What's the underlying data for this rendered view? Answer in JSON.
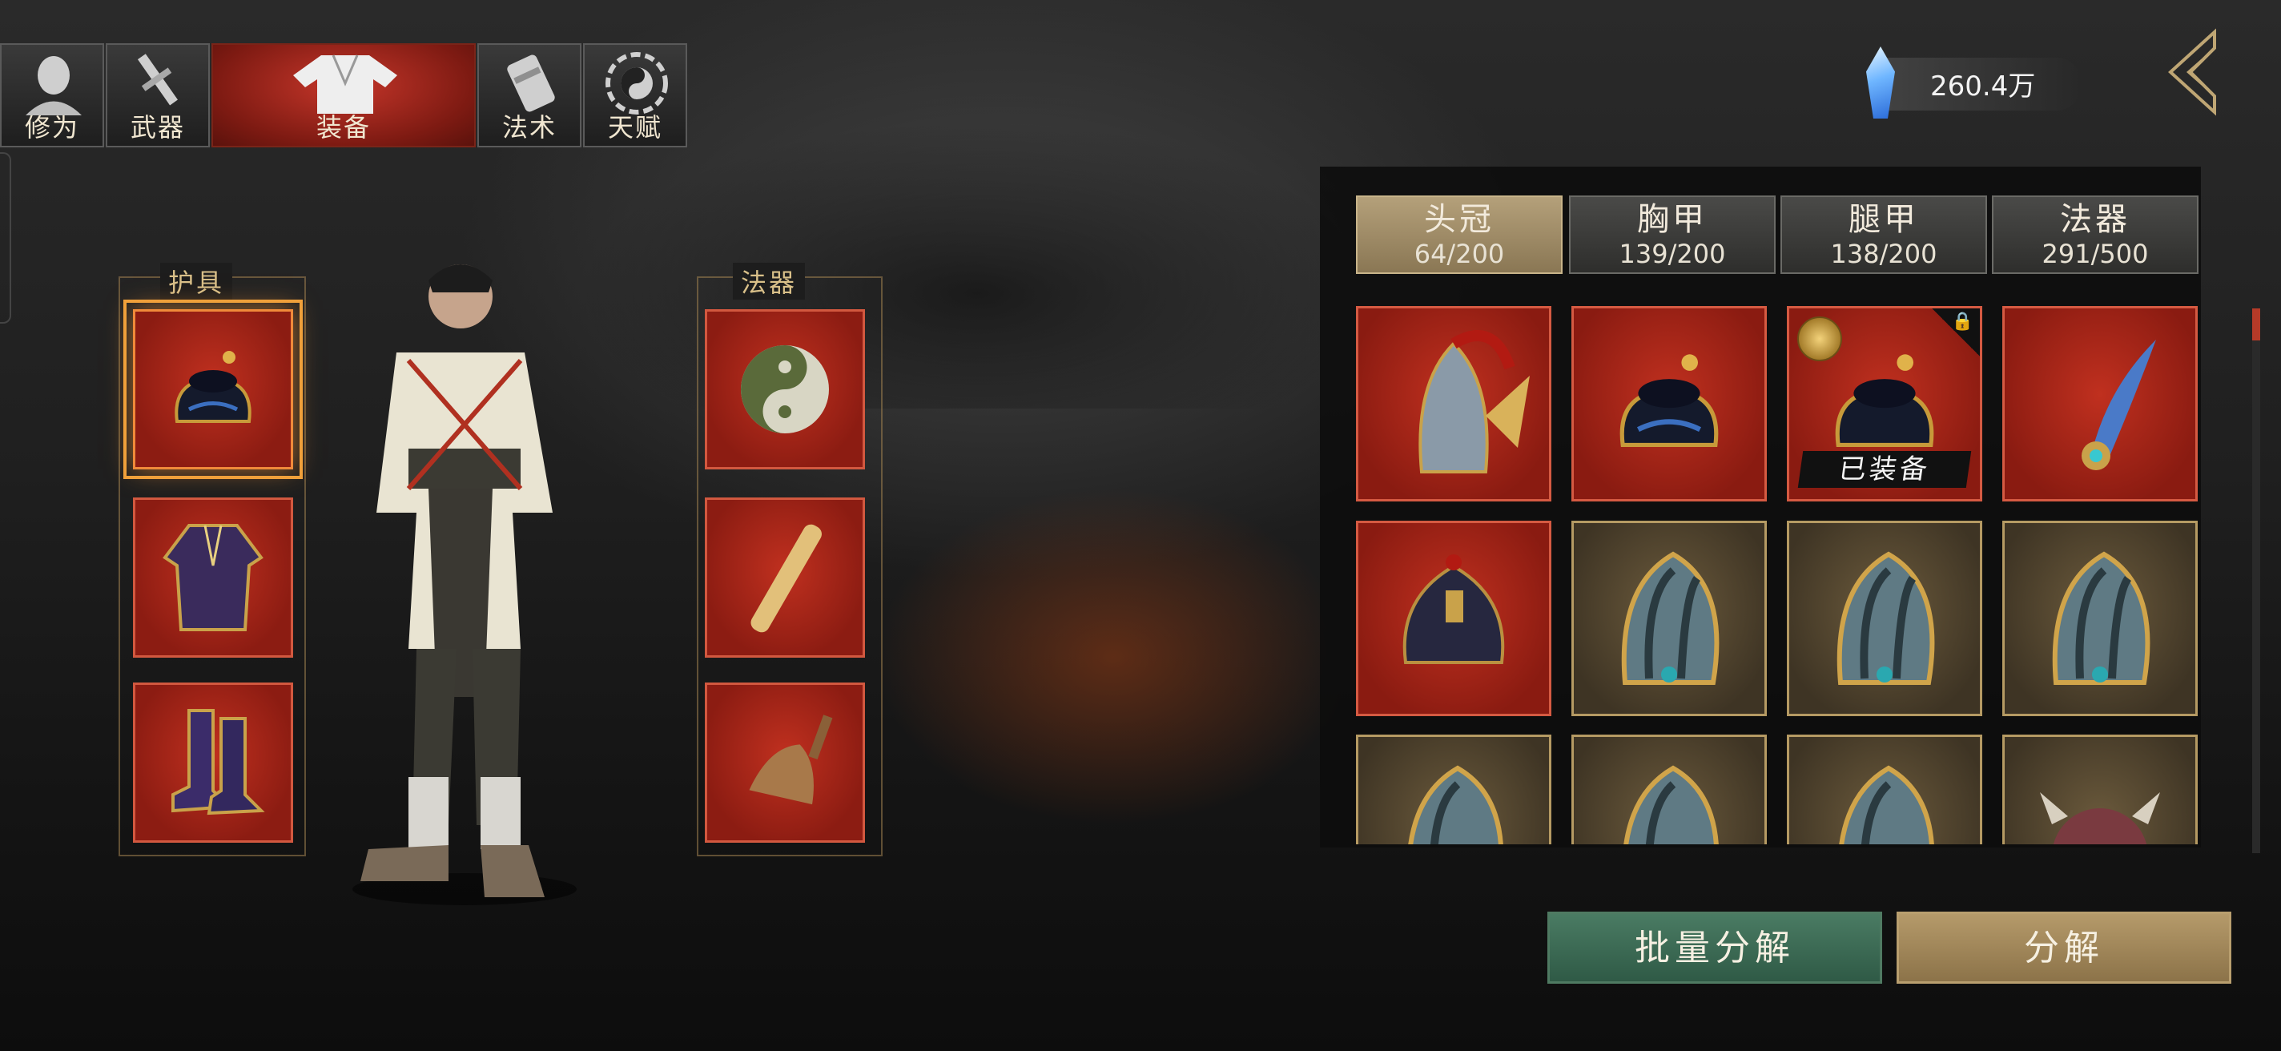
{
  "top_tabs": [
    {
      "label": "修为",
      "icon": "cultivator-head-icon"
    },
    {
      "label": "武器",
      "icon": "sword-icon"
    },
    {
      "label": "装备",
      "icon": "robe-icon",
      "active": true
    },
    {
      "label": "法术",
      "icon": "scroll-icon"
    },
    {
      "label": "天赋",
      "icon": "bagua-icon"
    }
  ],
  "currency": {
    "value": "260.4万",
    "icon": "spirit-crystal-icon"
  },
  "left_panel": {
    "armor_title": "护具",
    "artifact_title": "法器"
  },
  "categories": [
    {
      "label": "头冠",
      "count": "64/200",
      "active": true
    },
    {
      "label": "胸甲",
      "count": "139/200"
    },
    {
      "label": "腿甲",
      "count": "138/200"
    },
    {
      "label": "法器",
      "count": "291/500"
    }
  ],
  "equipped_label": "已装备",
  "buttons": {
    "batch_decompose": "批量分解",
    "decompose": "分解"
  },
  "colors": {
    "rare_red": "#c0301f",
    "common_gold": "#b59a63",
    "green_button": "#4a7b63",
    "tan_button": "#b59a6a"
  }
}
